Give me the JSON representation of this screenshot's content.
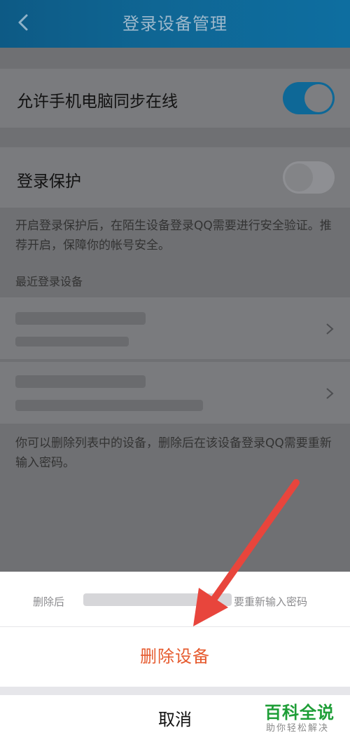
{
  "header": {
    "title": "登录设备管理"
  },
  "settings": {
    "sync_online_label": "允许手机电脑同步在线",
    "sync_online_on": true,
    "login_protection_label": "登录保护",
    "login_protection_on": false,
    "login_protection_desc": "开启登录保护后，在陌生设备登录QQ需要进行安全验证。推荐开启，保障你的帐号安全。"
  },
  "devices": {
    "section_title": "最近登录设备",
    "footer_note": "你可以删除列表中的设备，删除后在该设备登录QQ需要重新输入密码。"
  },
  "action_sheet": {
    "message_prefix": "删除后",
    "message_suffix": "要重新输入密码",
    "delete_label": "删除设备",
    "cancel_label": "取消"
  },
  "colors": {
    "header_bg": "#0f6694",
    "toggle_on": "#0e6897",
    "delete_text": "#e65a2e",
    "arrow": "#e8453c",
    "watermark": "#1e9e37"
  },
  "watermark": {
    "main": "百科全说",
    "sub": "助你轻松解决"
  }
}
